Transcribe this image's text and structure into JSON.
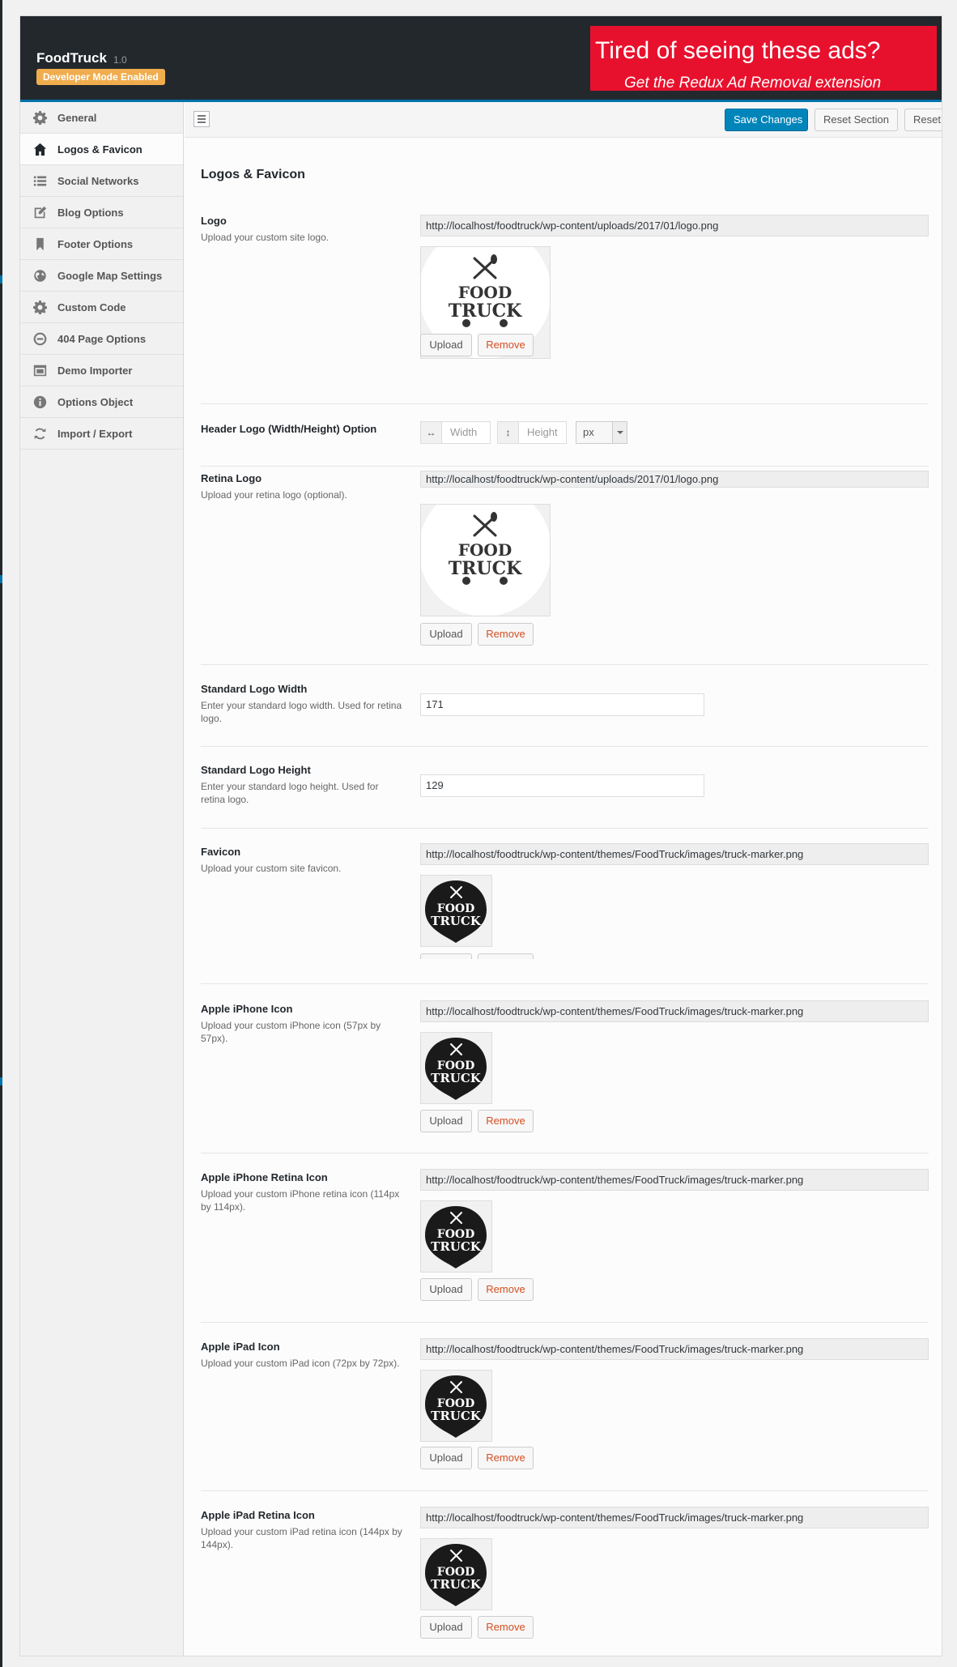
{
  "header": {
    "app_name": "FoodTruck",
    "version": "1.0",
    "dev_badge": "Developer Mode Enabled",
    "ad_title": "Tired of seeing these ads?",
    "ad_subtitle": "Get the Redux Ad Removal extension"
  },
  "sidebar": {
    "items": [
      {
        "label": "General",
        "icon": "gear-icon"
      },
      {
        "label": "Logos & Favicon",
        "icon": "home-icon",
        "active": true
      },
      {
        "label": "Social Networks",
        "icon": "list-icon"
      },
      {
        "label": "Blog Options",
        "icon": "edit-icon"
      },
      {
        "label": "Footer Options",
        "icon": "bookmark-icon"
      },
      {
        "label": "Google Map Settings",
        "icon": "globe-icon"
      },
      {
        "label": "Custom Code",
        "icon": "gear-icon"
      },
      {
        "label": "404 Page Options",
        "icon": "minus-circle-icon"
      },
      {
        "label": "Demo Importer",
        "icon": "window-icon"
      },
      {
        "label": "Options Object",
        "icon": "info-icon"
      },
      {
        "label": "Import / Export",
        "icon": "refresh-icon"
      }
    ]
  },
  "toolbar": {
    "save_label": "Save Changes",
    "reset_section_label": "Reset Section",
    "reset_all_label": "Reset All"
  },
  "section": {
    "title": "Logos & Favicon"
  },
  "buttons": {
    "upload": "Upload",
    "remove": "Remove"
  },
  "logo_text": {
    "line1": "FOOD",
    "line2": "TRUCK"
  },
  "fields": {
    "logo": {
      "label": "Logo",
      "desc": "Upload your custom site logo.",
      "url": "http://localhost/foodtruck/wp-content/uploads/2017/01/logo.png"
    },
    "header_logo": {
      "label": "Header Logo (Width/Height) Option",
      "width_placeholder": "Width",
      "height_placeholder": "Height",
      "unit": "px"
    },
    "retina_logo": {
      "label": "Retina Logo",
      "desc": "Upload your retina logo (optional).",
      "url": "http://localhost/foodtruck/wp-content/uploads/2017/01/logo.png"
    },
    "std_width": {
      "label": "Standard Logo Width",
      "desc": "Enter your standard logo width. Used for retina logo.",
      "value": "171"
    },
    "std_height": {
      "label": "Standard Logo Height",
      "desc": "Enter your standard logo height. Used for retina logo.",
      "value": "129"
    },
    "favicon": {
      "label": "Favicon",
      "desc": "Upload your custom site favicon.",
      "url": "http://localhost/foodtruck/wp-content/themes/FoodTruck/images/truck-marker.png"
    },
    "iphone": {
      "label": "Apple iPhone Icon",
      "desc": "Upload your custom iPhone icon (57px by 57px).",
      "url": "http://localhost/foodtruck/wp-content/themes/FoodTruck/images/truck-marker.png"
    },
    "iphone_retina": {
      "label": "Apple iPhone Retina Icon",
      "desc": "Upload your custom iPhone retina icon (114px by 114px).",
      "url": "http://localhost/foodtruck/wp-content/themes/FoodTruck/images/truck-marker.png"
    },
    "ipad": {
      "label": "Apple iPad Icon",
      "desc": "Upload your custom iPad icon (72px by 72px).",
      "url": "http://localhost/foodtruck/wp-content/themes/FoodTruck/images/truck-marker.png"
    },
    "ipad_retina": {
      "label": "Apple iPad Retina Icon",
      "desc": "Upload your custom iPad retina icon (144px by 144px).",
      "url": "http://localhost/foodtruck/wp-content/themes/FoodTruck/images/truck-marker.png"
    }
  }
}
